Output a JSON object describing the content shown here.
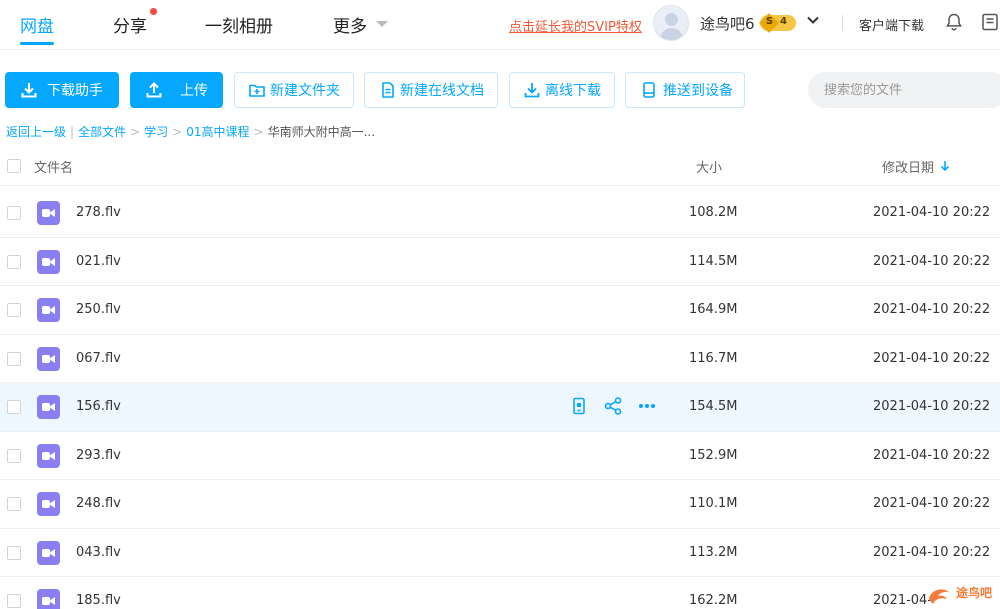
{
  "nav": {
    "tabs": [
      {
        "label": "网盘",
        "active": true
      },
      {
        "label": "分享",
        "badge": "dot"
      },
      {
        "label": "一刻相册"
      },
      {
        "label": "更多"
      }
    ],
    "svip_link": "点击延长我的SVIP特权",
    "username": "途鸟吧6",
    "vip_level": "S",
    "vip_num": "4",
    "client_download": "客户端下载",
    "icons": [
      "avatar",
      "chevron-down-icon",
      "bell-icon",
      "document-icon"
    ]
  },
  "toolbar": {
    "download_helper": "下载助手",
    "upload": "上传",
    "new_folder": "新建文件夹",
    "new_online_doc": "新建在线文档",
    "offline_download": "离线下载",
    "push_to_device": "推送到设备",
    "search_placeholder": "搜索您的文件"
  },
  "breadcrumb": {
    "back": "返回上一级",
    "items": [
      "全部文件",
      "学习",
      "01高中课程"
    ],
    "current": "华南师大附中高一..."
  },
  "table": {
    "headers": {
      "name": "文件名",
      "size": "大小",
      "date": "修改日期"
    },
    "sort": "date-desc",
    "rows": [
      {
        "name": "278.flv",
        "size": "108.2M",
        "date": "2021-04-10 20:22"
      },
      {
        "name": "021.flv",
        "size": "114.5M",
        "date": "2021-04-10 20:22"
      },
      {
        "name": "250.flv",
        "size": "164.9M",
        "date": "2021-04-10 20:22"
      },
      {
        "name": "067.flv",
        "size": "116.7M",
        "date": "2021-04-10 20:22"
      },
      {
        "name": "156.flv",
        "size": "154.5M",
        "date": "2021-04-10 20:22",
        "hover": true
      },
      {
        "name": "293.flv",
        "size": "152.9M",
        "date": "2021-04-10 20:22"
      },
      {
        "name": "248.flv",
        "size": "110.1M",
        "date": "2021-04-10 20:22"
      },
      {
        "name": "043.flv",
        "size": "113.2M",
        "date": "2021-04-10 20:22"
      },
      {
        "name": "185.flv",
        "size": "162.2M",
        "date": "2021-04-"
      }
    ]
  },
  "watermark": "途鸟吧",
  "colors": {
    "accent": "#06a7ff",
    "file_icon": "#8a7ff0",
    "svip": "#f05a3a",
    "hover_row": "#eef7fe"
  }
}
